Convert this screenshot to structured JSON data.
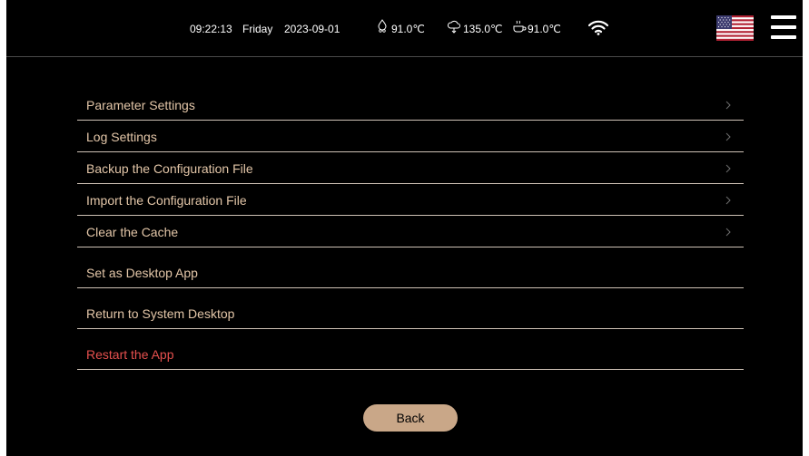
{
  "status_bar": {
    "time": "09:22:13",
    "day": "Friday",
    "date": "2023-09-01",
    "temp_1": "91.0℃",
    "temp_2": "135.0℃",
    "temp_3": "91.0℃",
    "wifi_icon": "wifi-icon",
    "language_flag": "us-flag-icon",
    "menu_icon": "hamburger-menu-icon"
  },
  "settings": {
    "items": [
      {
        "label": "Parameter Settings",
        "chevron": true
      },
      {
        "label": "Log Settings",
        "chevron": true
      },
      {
        "label": "Backup the Configuration File",
        "chevron": true
      },
      {
        "label": "Import the Configuration File",
        "chevron": true
      },
      {
        "label": "Clear the Cache",
        "chevron": true
      },
      {
        "label": "Set as Desktop App",
        "chevron": false
      },
      {
        "label": "Return to System Desktop",
        "chevron": false
      },
      {
        "label": "Restart the App",
        "chevron": false
      }
    ]
  },
  "back_button": {
    "label": "Back"
  },
  "colors": {
    "background": "#000000",
    "label_text": "#e3c6a8",
    "danger_text": "#e6504e",
    "button_bg": "#c9a788"
  }
}
